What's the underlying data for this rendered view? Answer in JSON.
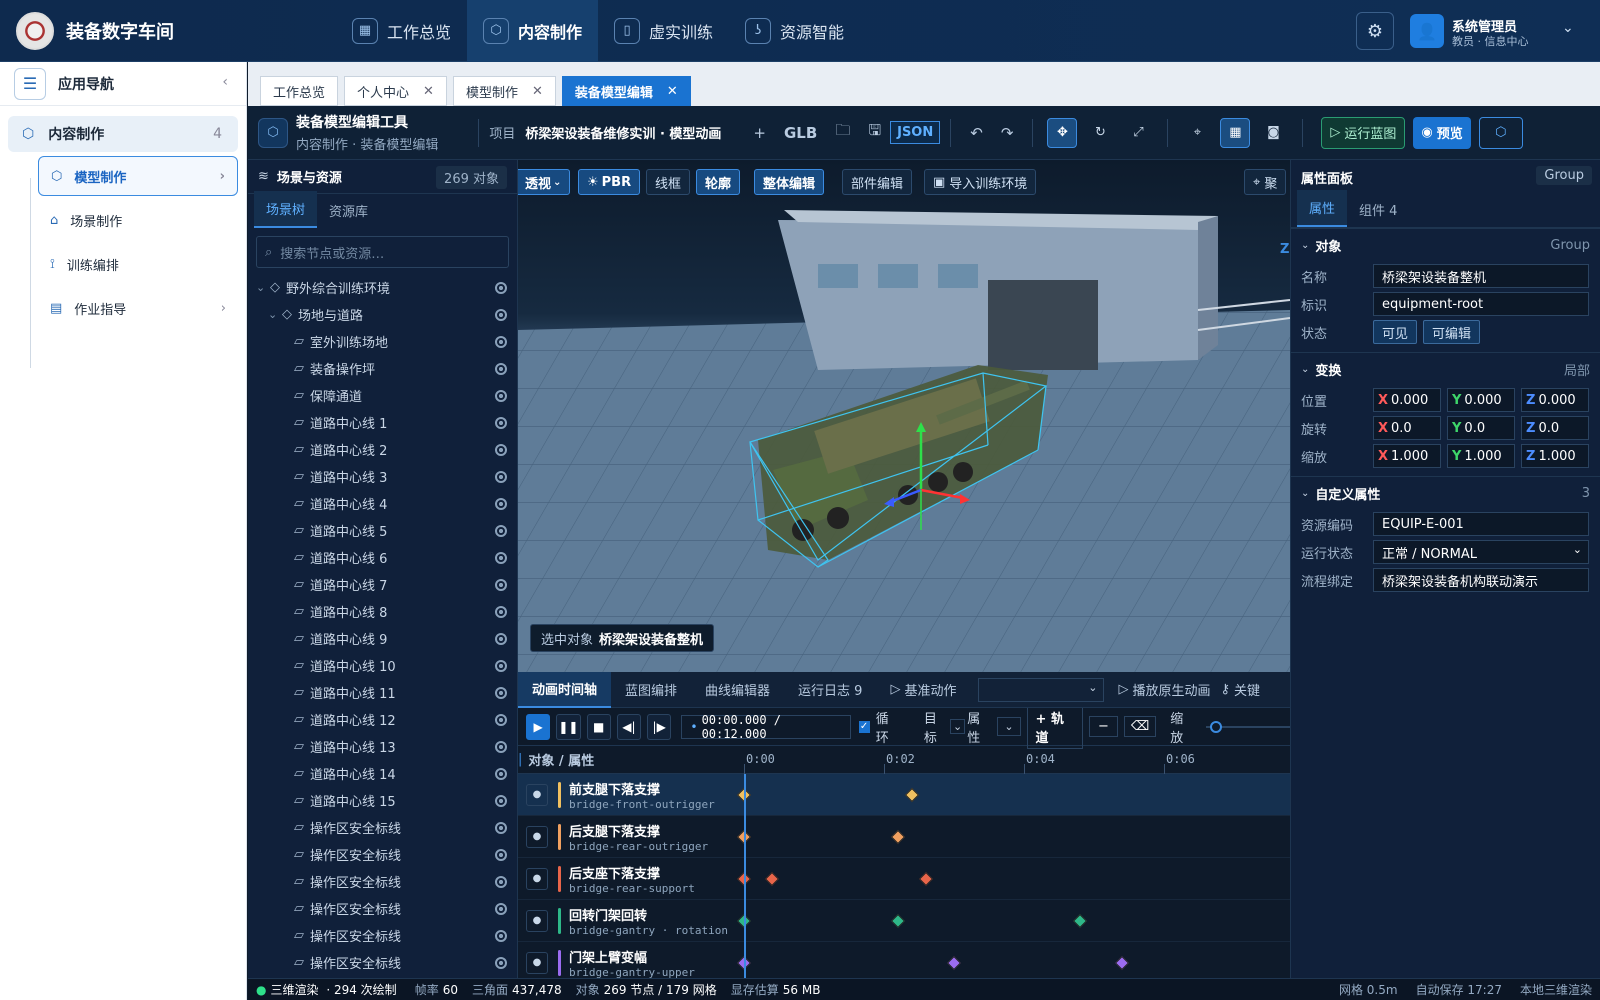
{
  "header": {
    "brand": "装备数字车间",
    "tabs": [
      {
        "label": "工作总览",
        "icon": "grid-icon"
      },
      {
        "label": "内容制作",
        "icon": "cube-icon"
      },
      {
        "label": "虚实训练",
        "icon": "book-icon"
      },
      {
        "label": "资源智能",
        "icon": "hook-icon"
      }
    ],
    "user": {
      "name": "系统管理员",
      "role": "教员 · 信息中心"
    }
  },
  "sidebar": {
    "title": "应用导航",
    "root": {
      "label": "内容制作",
      "count": "4"
    },
    "items": [
      {
        "label": "模型制作"
      },
      {
        "label": "场景制作"
      },
      {
        "label": "训练编排"
      },
      {
        "label": "作业指导"
      }
    ]
  },
  "page_tabs": [
    {
      "label": "工作总览"
    },
    {
      "label": "个人中心"
    },
    {
      "label": "模型制作"
    },
    {
      "label": "装备模型编辑"
    }
  ],
  "toolbar": {
    "title": "装备模型编辑工具",
    "breadcrumb": "内容制作 · 装备模型编辑",
    "project_label": "项目",
    "project_value": "桥梁架设装备维修实训 · 模型动画",
    "glb": "GLB",
    "json": "JSON",
    "run": "运行蓝图",
    "preview": "预览"
  },
  "scene": {
    "title": "场景与资源",
    "count": "269 对象",
    "tabs": [
      "场景树",
      "资源库"
    ],
    "search_placeholder": "搜索节点或资源…",
    "nodes": [
      {
        "label": "野外综合训练环境",
        "indent": 0,
        "caret": "⌄",
        "glyph": "◇"
      },
      {
        "label": "场地与道路",
        "indent": 1,
        "caret": "⌄",
        "glyph": "◇"
      },
      {
        "label": "室外训练场地",
        "indent": 2,
        "caret": "",
        "glyph": "▱"
      },
      {
        "label": "装备操作坪",
        "indent": 2,
        "caret": "",
        "glyph": "▱"
      },
      {
        "label": "保障通道",
        "indent": 2,
        "caret": "",
        "glyph": "▱"
      },
      {
        "label": "道路中心线 1",
        "indent": 2,
        "caret": "",
        "glyph": "▱"
      },
      {
        "label": "道路中心线 2",
        "indent": 2,
        "caret": "",
        "glyph": "▱"
      },
      {
        "label": "道路中心线 3",
        "indent": 2,
        "caret": "",
        "glyph": "▱"
      },
      {
        "label": "道路中心线 4",
        "indent": 2,
        "caret": "",
        "glyph": "▱"
      },
      {
        "label": "道路中心线 5",
        "indent": 2,
        "caret": "",
        "glyph": "▱"
      },
      {
        "label": "道路中心线 6",
        "indent": 2,
        "caret": "",
        "glyph": "▱"
      },
      {
        "label": "道路中心线 7",
        "indent": 2,
        "caret": "",
        "glyph": "▱"
      },
      {
        "label": "道路中心线 8",
        "indent": 2,
        "caret": "",
        "glyph": "▱"
      },
      {
        "label": "道路中心线 9",
        "indent": 2,
        "caret": "",
        "glyph": "▱"
      },
      {
        "label": "道路中心线 10",
        "indent": 2,
        "caret": "",
        "glyph": "▱"
      },
      {
        "label": "道路中心线 11",
        "indent": 2,
        "caret": "",
        "glyph": "▱"
      },
      {
        "label": "道路中心线 12",
        "indent": 2,
        "caret": "",
        "glyph": "▱"
      },
      {
        "label": "道路中心线 13",
        "indent": 2,
        "caret": "",
        "glyph": "▱"
      },
      {
        "label": "道路中心线 14",
        "indent": 2,
        "caret": "",
        "glyph": "▱"
      },
      {
        "label": "道路中心线 15",
        "indent": 2,
        "caret": "",
        "glyph": "▱"
      },
      {
        "label": "操作区安全标线",
        "indent": 2,
        "caret": "",
        "glyph": "▱"
      },
      {
        "label": "操作区安全标线",
        "indent": 2,
        "caret": "",
        "glyph": "▱"
      },
      {
        "label": "操作区安全标线",
        "indent": 2,
        "caret": "",
        "glyph": "▱"
      },
      {
        "label": "操作区安全标线",
        "indent": 2,
        "caret": "",
        "glyph": "▱"
      },
      {
        "label": "操作区安全标线",
        "indent": 2,
        "caret": "",
        "glyph": "▱"
      },
      {
        "label": "操作区安全标线",
        "indent": 2,
        "caret": "",
        "glyph": "▱"
      }
    ]
  },
  "viewport": {
    "modes": [
      "透视",
      "PBR",
      "线框",
      "轮廓",
      "整体编辑",
      "部件编辑",
      "导入训练环境"
    ],
    "focus": "聚",
    "axis_z": "Z",
    "selected_label": "选中对象",
    "selected_value": "桥梁架设装备整机"
  },
  "timeline": {
    "tabs": [
      "动画时间轴",
      "蓝图编排",
      "曲线编辑器",
      "运行日志 9"
    ],
    "base_action": "基准动作",
    "play_native": "播放原生动画",
    "key": "关键",
    "time": "00:00.000 / 00:12.000",
    "loop": "循环",
    "target": "目标",
    "attr": "属性",
    "add_track": "轨道",
    "zoom": "缩放",
    "col_header": "对象 / 属性",
    "ticks": [
      "0:00",
      "0:02",
      "0:04",
      "0:06"
    ],
    "tracks": [
      {
        "name": "前支腿下落支撑",
        "id": "bridge-front-outrigger",
        "color": "#f0c060",
        "keys": [
          0.0,
          2.4
        ]
      },
      {
        "name": "后支腿下落支撑",
        "id": "bridge-rear-outrigger",
        "color": "#f0a060",
        "keys": [
          0.0,
          2.2
        ]
      },
      {
        "name": "后支座下落支撑",
        "id": "bridge-rear-support",
        "color": "#e8654a",
        "keys": [
          0.0,
          0.4,
          2.6
        ]
      },
      {
        "name": "回转门架回转",
        "id": "bridge-gantry · rotation",
        "color": "#2eb889",
        "keys": [
          0.0,
          2.2,
          4.8
        ]
      },
      {
        "name": "门架上臂变幅",
        "id": "bridge-gantry-upper",
        "color": "#9b6cf0",
        "keys": [
          0.0,
          3.0,
          5.4
        ]
      }
    ]
  },
  "properties": {
    "title": "属性面板",
    "type": "Group",
    "tabs": [
      "属性",
      "组件 4"
    ],
    "object_section": "对象",
    "object_type": "Group",
    "name_label": "名称",
    "name_value": "桥梁架设装备整机",
    "id_label": "标识",
    "id_value": "equipment-root",
    "state_label": "状态",
    "states": [
      "可见",
      "可编辑"
    ],
    "transform_section": "变换",
    "transform_space": "局部",
    "position_label": "位置",
    "rotation_label": "旋转",
    "scale_label": "缩放",
    "position": [
      "0.000",
      "0.000",
      "0.000"
    ],
    "rotation": [
      "0.0",
      "0.0",
      "0.0"
    ],
    "scale": [
      "1.000",
      "1.000",
      "1.000"
    ],
    "custom_section": "自定义属性",
    "custom_count": "3",
    "code_label": "资源编码",
    "code_value": "EQUIP-E-001",
    "run_label": "运行状态",
    "run_value": "正常 / NORMAL",
    "flow_label": "流程绑定",
    "flow_value": "桥梁架设装备机构联动演示"
  },
  "status": {
    "render": "三维渲染",
    "draws": "294 次绘制",
    "fps_label": "帧率",
    "fps": "60",
    "tri_label": "三角面",
    "tri": "437,478",
    "obj_label": "对象",
    "obj": "269 节点 / 179 网格",
    "mem_label": "显存估算",
    "mem": "56 MB",
    "grid": "网格 0.5m",
    "autosave": "自动保存 17:27",
    "engine": "本地三维渲染"
  },
  "colors": {
    "accent": "#1a73d1",
    "topbar": "#0e2a4e",
    "panel": "#10203a"
  }
}
